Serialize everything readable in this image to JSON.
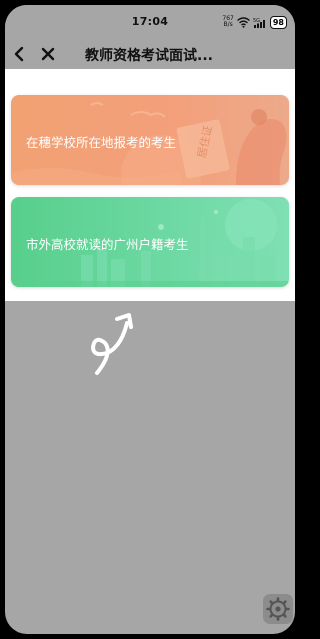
{
  "status_bar": {
    "time": "17:04",
    "net_speed_value": "767",
    "net_speed_unit": "B/s",
    "battery": "98",
    "icons": [
      "wifi-icon",
      "signal-5g-icon",
      "battery-icon"
    ]
  },
  "nav": {
    "title": "教师资格考试面试...",
    "icons": [
      "back-arrow-icon",
      "close-icon"
    ]
  },
  "cards": [
    {
      "label": "在穗学校所在地报考的考生",
      "art_text": "居住证",
      "color": "#f3a07b"
    },
    {
      "label": "市外高校就读的广州户籍考生",
      "color": "#62d497"
    }
  ],
  "overlay": {
    "dim_color": "#a6a6a6",
    "icons": [
      "swipe-gesture-icon",
      "settings-gear-icon"
    ]
  }
}
